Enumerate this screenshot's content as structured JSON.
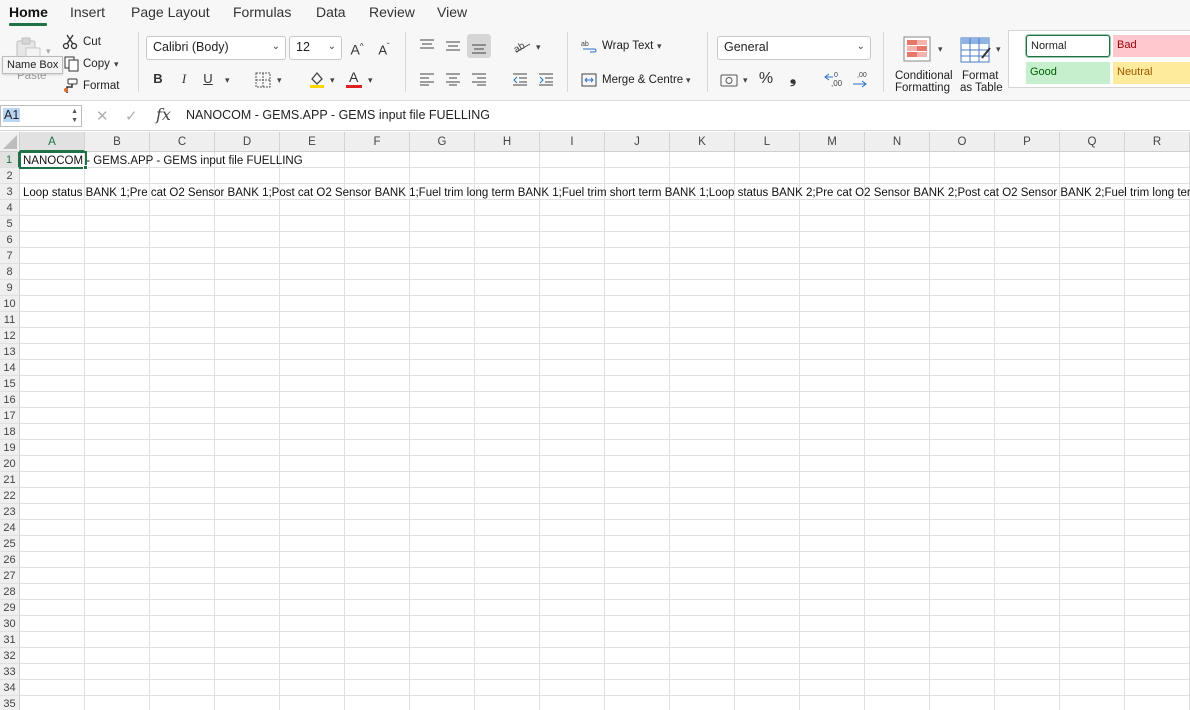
{
  "tabs": [
    "Home",
    "Insert",
    "Page Layout",
    "Formulas",
    "Data",
    "Review",
    "View"
  ],
  "clipboard": {
    "paste": "Paste",
    "cut": "Cut",
    "copy": "Copy",
    "format": "Format"
  },
  "tooltip": "Name Box",
  "font": {
    "family": "Calibri (Body)",
    "size": "12",
    "bold": "B",
    "italic": "I",
    "underline": "U"
  },
  "alignment": {
    "wrap_text": "Wrap Text",
    "merge": "Merge & Centre"
  },
  "number": {
    "format": "General",
    "percent": "%",
    "comma": "❟"
  },
  "styles": {
    "conditional_line1": "Conditional",
    "conditional_line2": "Formatting",
    "table_line1": "Format",
    "table_line2": "as Table",
    "normal": "Normal",
    "bad": "Bad",
    "good": "Good",
    "neutral": "Neutral"
  },
  "formula_bar": {
    "name_box": "A1",
    "formula": "NANOCOM - GEMS.APP - GEMS input file FUELLING"
  },
  "columns": [
    "A",
    "B",
    "C",
    "D",
    "E",
    "F",
    "G",
    "H",
    "I",
    "J",
    "K",
    "L",
    "M",
    "N",
    "O",
    "P",
    "Q",
    "R"
  ],
  "rows": [
    "1",
    "2",
    "3",
    "4",
    "5",
    "6",
    "7",
    "8",
    "9",
    "10",
    "11",
    "12",
    "13",
    "14",
    "15",
    "16",
    "17",
    "18",
    "19",
    "20",
    "21",
    "22",
    "23",
    "24",
    "25",
    "26",
    "27",
    "28",
    "29",
    "30",
    "31",
    "32",
    "33",
    "34",
    "35"
  ],
  "cells": {
    "a1": "NANOCOM - GEMS.APP - GEMS input file FUELLING",
    "a3": "Loop status BANK 1;Pre cat O2 Sensor BANK 1;Post cat O2 Sensor BANK 1;Fuel trim long term BANK 1;Fuel trim short term BANK 1;Loop status BANK 2;Pre cat O2 Sensor BANK 2;Post cat O2 Sensor BANK 2;Fuel trim long term BANK 2;Fue"
  },
  "colors": {
    "accent": "#1f7244",
    "bad_bg": "#ffc7ce",
    "bad_text": "#9c0006",
    "good_bg": "#c6efce",
    "good_text": "#006100",
    "neutral_bg": "#ffeb9c",
    "neutral_text": "#9c5700"
  }
}
